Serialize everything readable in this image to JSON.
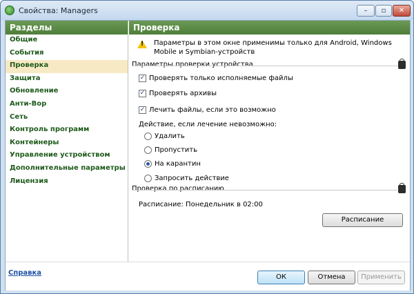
{
  "window": {
    "title": "Свойства: Managers",
    "minimize": "–",
    "maximize": "▫",
    "close": "✕"
  },
  "sidebar": {
    "header": "Разделы",
    "items": [
      {
        "label": "Общие"
      },
      {
        "label": "События"
      },
      {
        "label": "Проверка",
        "active": true
      },
      {
        "label": "Защита"
      },
      {
        "label": "Обновление"
      },
      {
        "label": "Анти-Вор"
      },
      {
        "label": "Сеть"
      },
      {
        "label": "Контроль программ"
      },
      {
        "label": "Контейнеры"
      },
      {
        "label": "Управление устройством"
      },
      {
        "label": "Дополнительные параметры"
      },
      {
        "label": "Лицензия"
      }
    ]
  },
  "main": {
    "header": "Проверка",
    "info_text": "Параметры в этом окне применимы только для Android, Windows Mobile и Symbian-устройств",
    "device_group": {
      "label": "Параметры проверки устройства",
      "checkbox_executables": "Проверять только исполняемые файлы",
      "checkbox_archives": "Проверять архивы",
      "checkbox_cure": "Лечить файлы, если это возможно",
      "action_label": "Действие, если лечение невозможно:",
      "radio_delete": "Удалить",
      "radio_skip": "Пропустить",
      "radio_quarantine": "На карантин",
      "radio_ask": "Запросить действие",
      "selected": "На карантин"
    },
    "schedule_group": {
      "label": "Проверка по расписанию",
      "schedule_text": "Расписание: Понедельник в 02:00",
      "schedule_button": "Расписание"
    }
  },
  "footer": {
    "help": "Справка",
    "ok": "ОК",
    "cancel": "Отмена",
    "apply": "Применить"
  }
}
